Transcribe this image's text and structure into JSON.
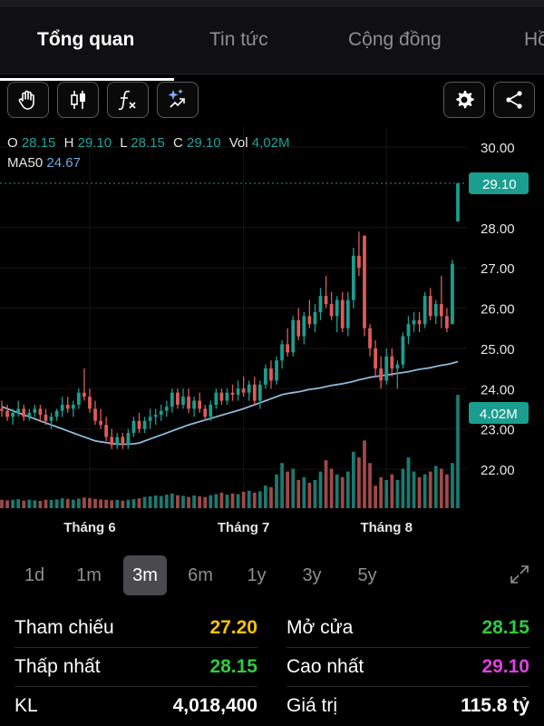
{
  "tabs": [
    {
      "label": "Tổng quan",
      "active": true
    },
    {
      "label": "Tin tức",
      "active": false
    },
    {
      "label": "Cộng đồng",
      "active": false
    },
    {
      "label": "Hồ",
      "active": false
    }
  ],
  "toolbar": {
    "icons": [
      "hand-icon",
      "candlestick-icon",
      "function-icon",
      "magic-icon",
      "gear-icon",
      "share-icon"
    ]
  },
  "ohlc": {
    "o_label": "O",
    "o": "28.15",
    "h_label": "H",
    "h": "29.10",
    "l_label": "L",
    "l": "28.15",
    "c_label": "C",
    "c": "29.10",
    "vol_label": "Vol",
    "vol": "4,02M",
    "ma_label": "MA50",
    "ma": "24.67"
  },
  "chart_data": {
    "type": "candlestick",
    "price_ticks": [
      "30.00",
      "28.00",
      "27.00",
      "26.00",
      "25.00",
      "24.00",
      "23.00",
      "22.00"
    ],
    "x_labels": [
      "Tháng 6",
      "Tháng 7",
      "Tháng 8"
    ],
    "last_price_label": "29.10",
    "last_volume_label": "4.02M",
    "last_price": 29.1,
    "ylim": [
      21.0,
      30.5
    ],
    "colors": {
      "up": "#1a9e8f",
      "down": "#e05a5a",
      "ma": "#8fb8d8",
      "vol_up": "#1a7a70",
      "vol_down": "#a04848"
    },
    "candles": [
      [
        23.5,
        23.7,
        23.3,
        23.45
      ],
      [
        23.45,
        23.6,
        23.2,
        23.3
      ],
      [
        23.3,
        23.5,
        23.1,
        23.4
      ],
      [
        23.4,
        23.7,
        23.3,
        23.5
      ],
      [
        23.5,
        23.6,
        23.2,
        23.3
      ],
      [
        23.3,
        23.5,
        23.2,
        23.4
      ],
      [
        23.4,
        23.6,
        23.3,
        23.5
      ],
      [
        23.5,
        23.6,
        23.2,
        23.35
      ],
      [
        23.35,
        23.5,
        23.1,
        23.2
      ],
      [
        23.2,
        23.4,
        23.0,
        23.3
      ],
      [
        23.3,
        23.5,
        23.2,
        23.45
      ],
      [
        23.45,
        23.8,
        23.3,
        23.6
      ],
      [
        23.6,
        23.8,
        23.4,
        23.5
      ],
      [
        23.5,
        23.7,
        23.3,
        23.6
      ],
      [
        23.6,
        24.0,
        23.5,
        23.9
      ],
      [
        23.9,
        24.5,
        23.7,
        23.8
      ],
      [
        23.8,
        24.0,
        23.4,
        23.5
      ],
      [
        23.5,
        23.7,
        23.1,
        23.2
      ],
      [
        23.2,
        23.5,
        23.0,
        23.1
      ],
      [
        23.1,
        23.3,
        22.7,
        22.8
      ],
      [
        22.8,
        23.0,
        22.5,
        22.6
      ],
      [
        22.6,
        22.9,
        22.5,
        22.8
      ],
      [
        22.8,
        22.9,
        22.5,
        22.6
      ],
      [
        22.6,
        23.0,
        22.5,
        22.9
      ],
      [
        22.9,
        23.3,
        22.8,
        23.2
      ],
      [
        23.2,
        23.4,
        22.9,
        23.0
      ],
      [
        23.0,
        23.3,
        22.9,
        23.2
      ],
      [
        23.2,
        23.5,
        23.0,
        23.3
      ],
      [
        23.3,
        23.5,
        23.1,
        23.35
      ],
      [
        23.35,
        23.6,
        23.2,
        23.45
      ],
      [
        23.45,
        23.7,
        23.3,
        23.55
      ],
      [
        23.55,
        24.0,
        23.4,
        23.9
      ],
      [
        23.9,
        24.0,
        23.5,
        23.6
      ],
      [
        23.6,
        24.0,
        23.5,
        23.8
      ],
      [
        23.8,
        24.0,
        23.4,
        23.5
      ],
      [
        23.5,
        23.8,
        23.3,
        23.7
      ],
      [
        23.7,
        23.9,
        23.4,
        23.5
      ],
      [
        23.5,
        23.6,
        23.2,
        23.3
      ],
      [
        23.3,
        23.7,
        23.2,
        23.6
      ],
      [
        23.6,
        24.0,
        23.5,
        23.9
      ],
      [
        23.9,
        24.0,
        23.6,
        23.7
      ],
      [
        23.7,
        24.0,
        23.6,
        23.9
      ],
      [
        23.9,
        24.1,
        23.7,
        23.85
      ],
      [
        23.85,
        24.2,
        23.7,
        24.0
      ],
      [
        24.0,
        24.3,
        23.8,
        23.9
      ],
      [
        23.9,
        24.2,
        23.7,
        24.1
      ],
      [
        24.1,
        24.3,
        23.6,
        23.7
      ],
      [
        23.7,
        24.2,
        23.5,
        24.1
      ],
      [
        24.1,
        24.6,
        24.0,
        24.5
      ],
      [
        24.5,
        24.7,
        24.0,
        24.2
      ],
      [
        24.2,
        24.8,
        24.1,
        24.7
      ],
      [
        24.7,
        25.2,
        24.5,
        25.1
      ],
      [
        25.1,
        25.5,
        24.8,
        24.9
      ],
      [
        24.9,
        25.8,
        24.8,
        25.7
      ],
      [
        25.7,
        26.0,
        25.2,
        25.3
      ],
      [
        25.3,
        25.9,
        25.1,
        25.8
      ],
      [
        25.8,
        26.2,
        25.5,
        25.6
      ],
      [
        25.6,
        26.1,
        25.4,
        25.9
      ],
      [
        25.9,
        26.5,
        25.7,
        26.3
      ],
      [
        26.3,
        26.8,
        26.0,
        26.1
      ],
      [
        26.1,
        26.4,
        25.7,
        25.8
      ],
      [
        25.8,
        26.3,
        25.4,
        26.2
      ],
      [
        26.2,
        26.4,
        25.4,
        25.5
      ],
      [
        25.5,
        26.4,
        25.3,
        26.2
      ],
      [
        26.2,
        27.5,
        26.0,
        27.3
      ],
      [
        27.3,
        27.9,
        26.8,
        27.0
      ],
      [
        27.8,
        27.8,
        25.3,
        25.5
      ],
      [
        25.5,
        25.6,
        24.8,
        25.0
      ],
      [
        25.0,
        25.2,
        24.3,
        24.5
      ],
      [
        24.5,
        24.8,
        24.0,
        24.2
      ],
      [
        24.2,
        25.0,
        24.1,
        24.8
      ],
      [
        24.8,
        25.0,
        24.3,
        24.5
      ],
      [
        24.5,
        24.7,
        24.0,
        24.6
      ],
      [
        24.6,
        25.4,
        24.5,
        25.3
      ],
      [
        25.3,
        25.8,
        25.1,
        25.6
      ],
      [
        25.6,
        25.9,
        25.4,
        25.7
      ],
      [
        25.7,
        25.9,
        25.4,
        25.6
      ],
      [
        25.6,
        26.4,
        25.5,
        26.3
      ],
      [
        26.3,
        26.5,
        25.7,
        25.8
      ],
      [
        25.8,
        26.2,
        25.6,
        26.1
      ],
      [
        26.1,
        26.8,
        25.5,
        25.8
      ],
      [
        25.8,
        26.0,
        25.4,
        25.5
      ],
      [
        25.6,
        27.2,
        25.6,
        27.1
      ],
      [
        28.15,
        29.1,
        28.15,
        29.1
      ]
    ],
    "volume": [
      0.3,
      0.28,
      0.3,
      0.32,
      0.27,
      0.3,
      0.28,
      0.26,
      0.3,
      0.29,
      0.31,
      0.35,
      0.33,
      0.3,
      0.34,
      0.38,
      0.36,
      0.33,
      0.31,
      0.3,
      0.28,
      0.29,
      0.27,
      0.3,
      0.32,
      0.35,
      0.4,
      0.42,
      0.45,
      0.43,
      0.48,
      0.52,
      0.46,
      0.44,
      0.4,
      0.45,
      0.42,
      0.4,
      0.46,
      0.5,
      0.55,
      0.48,
      0.52,
      0.5,
      0.58,
      0.62,
      0.55,
      0.6,
      0.8,
      0.75,
      1.2,
      1.6,
      1.3,
      1.4,
      1.0,
      1.1,
      0.9,
      1.0,
      1.3,
      1.7,
      1.4,
      1.2,
      1.1,
      1.3,
      2.0,
      1.8,
      2.4,
      1.6,
      0.8,
      1.1,
      1.0,
      1.2,
      1.0,
      1.4,
      1.8,
      1.3,
      1.1,
      1.2,
      1.3,
      1.5,
      1.4,
      1.2,
      1.6,
      4.02
    ],
    "ma50": [
      23.55,
      23.5,
      23.45,
      23.4,
      23.35,
      23.3,
      23.25,
      23.2,
      23.15,
      23.1,
      23.05,
      23.0,
      22.95,
      22.9,
      22.85,
      22.8,
      22.75,
      22.7,
      22.68,
      22.66,
      22.64,
      22.62,
      22.62,
      22.62,
      22.63,
      22.65,
      22.7,
      22.75,
      22.8,
      22.85,
      22.9,
      22.95,
      23.0,
      23.05,
      23.1,
      23.14,
      23.18,
      23.22,
      23.26,
      23.3,
      23.34,
      23.38,
      23.42,
      23.46,
      23.5,
      23.55,
      23.6,
      23.65,
      23.7,
      23.75,
      23.8,
      23.85,
      23.88,
      23.9,
      23.92,
      23.95,
      23.98,
      24.0,
      24.02,
      24.05,
      24.08,
      24.1,
      24.12,
      24.15,
      24.18,
      24.22,
      24.25,
      24.28,
      24.3,
      24.32,
      24.34,
      24.36,
      24.38,
      24.4,
      24.42,
      24.45,
      24.48,
      24.5,
      24.52,
      24.55,
      24.58,
      24.6,
      24.63,
      24.67
    ]
  },
  "ranges": [
    {
      "label": "1d",
      "active": false
    },
    {
      "label": "1m",
      "active": false
    },
    {
      "label": "3m",
      "active": true
    },
    {
      "label": "6m",
      "active": false
    },
    {
      "label": "1y",
      "active": false
    },
    {
      "label": "3y",
      "active": false
    },
    {
      "label": "5y",
      "active": false
    }
  ],
  "stats": {
    "tham_chieu_label": "Tham chiếu",
    "tham_chieu": "27.20",
    "tham_chieu_color": "#f5c400",
    "mo_cua_label": "Mở cửa",
    "mo_cua": "28.15",
    "mo_cua_color": "#2ecc40",
    "thap_nhat_label": "Thấp nhất",
    "thap_nhat": "28.15",
    "thap_nhat_color": "#2ecc40",
    "cao_nhat_label": "Cao nhất",
    "cao_nhat": "29.10",
    "cao_nhat_color": "#e040e0",
    "kl_label": "KL",
    "kl": "4,018,400",
    "kl_color": "#ffffff",
    "gia_tri_label": "Giá trị",
    "gia_tri": "115.8 tỷ",
    "gia_tri_color": "#ffffff"
  }
}
